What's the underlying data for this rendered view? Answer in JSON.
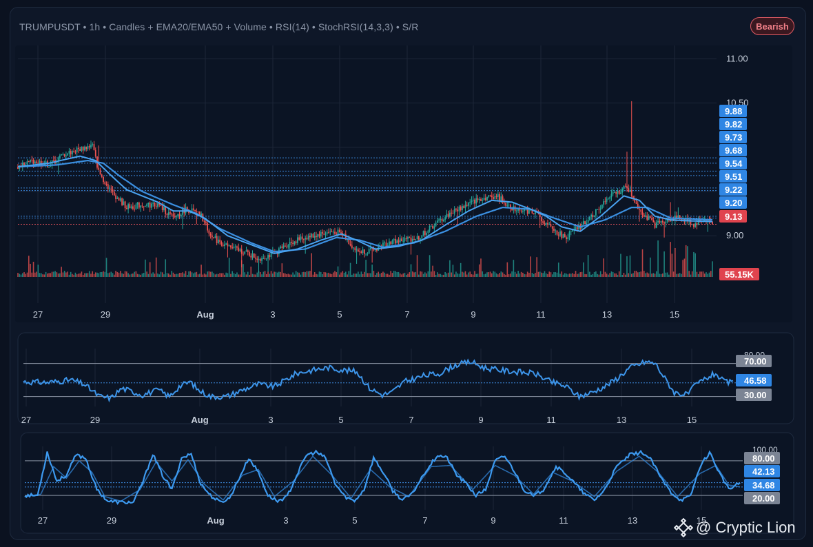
{
  "header": {
    "title": "TRUMPUSDT • 1h • Candles + EMA20/EMA50 + Volume • RSI(14) • StochRSI(14,3,3) • S/R",
    "badge": "Bearish"
  },
  "colors": {
    "up": "#26a69a",
    "down": "#ef5350",
    "ema": "#3b8fe0",
    "grid": "#1c2638",
    "level": "#3f8fe6",
    "levelRed": "#e0505a",
    "badgeBlue": "#2f86e4",
    "badgeRed": "#e0444e"
  },
  "chart_data": [
    {
      "type": "candlestick",
      "title": "TRUMPUSDT • 1h",
      "x_ticks": [
        "27",
        "29",
        "Aug",
        "3",
        "5",
        "7",
        "9",
        "11",
        "13",
        "15"
      ],
      "y_ticks": [
        "11.00",
        "10.50",
        "9.00"
      ],
      "ylim": [
        8.55,
        11.15
      ],
      "close_anchors": [
        [
          0,
          9.78
        ],
        [
          10,
          9.85
        ],
        [
          20,
          9.8
        ],
        [
          30,
          9.92
        ],
        [
          40,
          9.98
        ],
        [
          48,
          10.02
        ],
        [
          52,
          9.72
        ],
        [
          60,
          9.5
        ],
        [
          70,
          9.32
        ],
        [
          80,
          9.35
        ],
        [
          90,
          9.35
        ],
        [
          100,
          9.2
        ],
        [
          108,
          9.3
        ],
        [
          112,
          9.28
        ],
        [
          118,
          9.22
        ],
        [
          125,
          8.98
        ],
        [
          135,
          8.88
        ],
        [
          145,
          8.82
        ],
        [
          155,
          8.74
        ],
        [
          165,
          8.8
        ],
        [
          175,
          8.92
        ],
        [
          185,
          8.98
        ],
        [
          195,
          9.02
        ],
        [
          205,
          9.05
        ],
        [
          210,
          9.0
        ],
        [
          218,
          8.82
        ],
        [
          228,
          8.83
        ],
        [
          238,
          8.92
        ],
        [
          248,
          8.95
        ],
        [
          258,
          8.98
        ],
        [
          268,
          9.12
        ],
        [
          278,
          9.25
        ],
        [
          288,
          9.34
        ],
        [
          298,
          9.42
        ],
        [
          308,
          9.45
        ],
        [
          318,
          9.32
        ],
        [
          328,
          9.28
        ],
        [
          335,
          9.25
        ],
        [
          340,
          9.12
        ],
        [
          352,
          8.98
        ],
        [
          362,
          9.1
        ],
        [
          372,
          9.28
        ],
        [
          382,
          9.45
        ],
        [
          392,
          9.55
        ],
        [
          400,
          9.3
        ],
        [
          405,
          9.2
        ],
        [
          410,
          9.12
        ],
        [
          418,
          9.18
        ],
        [
          425,
          9.2
        ],
        [
          430,
          9.18
        ],
        [
          435,
          9.12
        ],
        [
          440,
          9.18
        ],
        [
          447,
          9.15
        ]
      ],
      "spikes": [
        [
          52,
          10.02
        ],
        [
          395,
          10.52
        ],
        [
          392,
          9.95
        ],
        [
          420,
          9.38
        ],
        [
          425,
          9.32
        ]
      ],
      "total_candles": 448,
      "ema20_anchors": [
        [
          0,
          9.78
        ],
        [
          20,
          9.82
        ],
        [
          40,
          9.9
        ],
        [
          50,
          9.85
        ],
        [
          60,
          9.68
        ],
        [
          70,
          9.52
        ],
        [
          90,
          9.38
        ],
        [
          100,
          9.28
        ],
        [
          110,
          9.28
        ],
        [
          120,
          9.2
        ],
        [
          135,
          9.0
        ],
        [
          150,
          8.9
        ],
        [
          165,
          8.8
        ],
        [
          180,
          8.85
        ],
        [
          195,
          8.95
        ],
        [
          208,
          9.02
        ],
        [
          218,
          8.95
        ],
        [
          230,
          8.85
        ],
        [
          245,
          8.88
        ],
        [
          260,
          8.95
        ],
        [
          275,
          9.12
        ],
        [
          290,
          9.28
        ],
        [
          305,
          9.4
        ],
        [
          318,
          9.38
        ],
        [
          330,
          9.3
        ],
        [
          340,
          9.22
        ],
        [
          350,
          9.1
        ],
        [
          362,
          9.05
        ],
        [
          375,
          9.22
        ],
        [
          390,
          9.45
        ],
        [
          400,
          9.4
        ],
        [
          410,
          9.22
        ],
        [
          420,
          9.18
        ],
        [
          430,
          9.17
        ],
        [
          447,
          9.16
        ]
      ],
      "ema50_anchors": [
        [
          0,
          9.78
        ],
        [
          25,
          9.8
        ],
        [
          45,
          9.85
        ],
        [
          55,
          9.82
        ],
        [
          65,
          9.68
        ],
        [
          80,
          9.5
        ],
        [
          100,
          9.35
        ],
        [
          115,
          9.25
        ],
        [
          130,
          9.08
        ],
        [
          150,
          8.92
        ],
        [
          165,
          8.82
        ],
        [
          185,
          8.85
        ],
        [
          205,
          8.98
        ],
        [
          220,
          8.95
        ],
        [
          235,
          8.87
        ],
        [
          255,
          8.92
        ],
        [
          275,
          9.05
        ],
        [
          295,
          9.22
        ],
        [
          312,
          9.32
        ],
        [
          330,
          9.3
        ],
        [
          345,
          9.2
        ],
        [
          362,
          9.1
        ],
        [
          378,
          9.18
        ],
        [
          395,
          9.32
        ],
        [
          405,
          9.32
        ],
        [
          420,
          9.2
        ],
        [
          447,
          9.18
        ]
      ],
      "sr_levels": [
        9.88,
        9.82,
        9.73,
        9.68,
        9.54,
        9.51,
        9.22,
        9.2
      ],
      "sr_levels_red": [
        9.13
      ],
      "price_labels": [
        "9.88",
        "9.82",
        "9.73",
        "9.68",
        "9.54",
        "9.51",
        "9.22",
        "9.20"
      ],
      "current_price": "9.13",
      "volume_label": "55.15K"
    },
    {
      "type": "line",
      "title": "RSI(14)",
      "ylim": [
        18,
        88
      ],
      "y_ticks": [
        "80.00"
      ],
      "x_ticks": [
        "27",
        "29",
        "Aug",
        "3",
        "5",
        "7",
        "9",
        "11",
        "13",
        "15"
      ],
      "reference_lines": [
        70,
        30
      ],
      "labels": {
        "upper": "70.00",
        "current": "46.58",
        "lower": "30.00"
      },
      "anchors": [
        [
          0,
          48
        ],
        [
          15,
          47
        ],
        [
          30,
          50
        ],
        [
          38,
          45
        ],
        [
          48,
          30
        ],
        [
          55,
          28
        ],
        [
          62,
          40
        ],
        [
          75,
          32
        ],
        [
          85,
          38
        ],
        [
          92,
          30
        ],
        [
          98,
          42
        ],
        [
          105,
          48
        ],
        [
          110,
          38
        ],
        [
          118,
          30
        ],
        [
          128,
          30
        ],
        [
          138,
          38
        ],
        [
          148,
          45
        ],
        [
          158,
          42
        ],
        [
          165,
          50
        ],
        [
          172,
          58
        ],
        [
          182,
          62
        ],
        [
          192,
          65
        ],
        [
          202,
          62
        ],
        [
          210,
          60
        ],
        [
          218,
          40
        ],
        [
          226,
          32
        ],
        [
          232,
          35
        ],
        [
          240,
          48
        ],
        [
          252,
          55
        ],
        [
          262,
          58
        ],
        [
          272,
          68
        ],
        [
          282,
          72
        ],
        [
          290,
          65
        ],
        [
          300,
          62
        ],
        [
          310,
          60
        ],
        [
          322,
          58
        ],
        [
          332,
          48
        ],
        [
          342,
          42
        ],
        [
          350,
          30
        ],
        [
          358,
          35
        ],
        [
          366,
          42
        ],
        [
          374,
          52
        ],
        [
          382,
          65
        ],
        [
          392,
          72
        ],
        [
          398,
          70
        ],
        [
          404,
          52
        ],
        [
          410,
          35
        ],
        [
          418,
          32
        ],
        [
          424,
          45
        ],
        [
          430,
          52
        ],
        [
          436,
          58
        ],
        [
          441,
          48
        ],
        [
          447,
          46.58
        ]
      ]
    },
    {
      "type": "line",
      "title": "StochRSI(14,3,3)",
      "ylim": [
        -5,
        105
      ],
      "y_ticks": [
        "100.00"
      ],
      "x_ticks": [
        "27",
        "29",
        "Aug",
        "3",
        "5",
        "7",
        "9",
        "11",
        "13",
        "15"
      ],
      "reference_lines": [
        80,
        20
      ],
      "labels": {
        "upper": "80.00",
        "k": "42.13",
        "d": "34.68",
        "lower": "20.00"
      },
      "anchors": [
        [
          0,
          20
        ],
        [
          8,
          20
        ],
        [
          14,
          95
        ],
        [
          20,
          45
        ],
        [
          26,
          55
        ],
        [
          32,
          90
        ],
        [
          38,
          85
        ],
        [
          45,
          30
        ],
        [
          52,
          10
        ],
        [
          60,
          8
        ],
        [
          68,
          8
        ],
        [
          74,
          45
        ],
        [
          80,
          92
        ],
        [
          86,
          55
        ],
        [
          92,
          30
        ],
        [
          98,
          85
        ],
        [
          104,
          92
        ],
        [
          110,
          40
        ],
        [
          116,
          20
        ],
        [
          122,
          8
        ],
        [
          128,
          15
        ],
        [
          134,
          50
        ],
        [
          140,
          85
        ],
        [
          146,
          60
        ],
        [
          152,
          20
        ],
        [
          158,
          10
        ],
        [
          164,
          18
        ],
        [
          170,
          55
        ],
        [
          176,
          90
        ],
        [
          182,
          95
        ],
        [
          188,
          85
        ],
        [
          194,
          40
        ],
        [
          200,
          18
        ],
        [
          206,
          10
        ],
        [
          212,
          30
        ],
        [
          218,
          85
        ],
        [
          224,
          60
        ],
        [
          230,
          28
        ],
        [
          236,
          12
        ],
        [
          242,
          22
        ],
        [
          250,
          60
        ],
        [
          258,
          90
        ],
        [
          264,
          85
        ],
        [
          270,
          55
        ],
        [
          276,
          40
        ],
        [
          282,
          20
        ],
        [
          288,
          30
        ],
        [
          294,
          80
        ],
        [
          300,
          88
        ],
        [
          306,
          62
        ],
        [
          312,
          30
        ],
        [
          318,
          18
        ],
        [
          324,
          30
        ],
        [
          332,
          70
        ],
        [
          338,
          58
        ],
        [
          344,
          40
        ],
        [
          350,
          22
        ],
        [
          356,
          12
        ],
        [
          362,
          28
        ],
        [
          370,
          70
        ],
        [
          378,
          90
        ],
        [
          386,
          95
        ],
        [
          392,
          80
        ],
        [
          398,
          48
        ],
        [
          404,
          25
        ],
        [
          410,
          12
        ],
        [
          416,
          18
        ],
        [
          422,
          70
        ],
        [
          428,
          95
        ],
        [
          434,
          60
        ],
        [
          440,
          30
        ],
        [
          447,
          42
        ]
      ],
      "anchors_d": [
        [
          0,
          18
        ],
        [
          10,
          22
        ],
        [
          18,
          70
        ],
        [
          26,
          50
        ],
        [
          34,
          80
        ],
        [
          42,
          60
        ],
        [
          50,
          18
        ],
        [
          60,
          10
        ],
        [
          72,
          30
        ],
        [
          82,
          78
        ],
        [
          92,
          45
        ],
        [
          102,
          82
        ],
        [
          112,
          40
        ],
        [
          124,
          12
        ],
        [
          136,
          55
        ],
        [
          146,
          65
        ],
        [
          156,
          18
        ],
        [
          168,
          45
        ],
        [
          180,
          88
        ],
        [
          192,
          55
        ],
        [
          204,
          15
        ],
        [
          216,
          65
        ],
        [
          228,
          35
        ],
        [
          240,
          18
        ],
        [
          254,
          70
        ],
        [
          266,
          72
        ],
        [
          280,
          30
        ],
        [
          294,
          72
        ],
        [
          306,
          55
        ],
        [
          318,
          22
        ],
        [
          330,
          60
        ],
        [
          342,
          45
        ],
        [
          356,
          18
        ],
        [
          370,
          62
        ],
        [
          384,
          88
        ],
        [
          396,
          60
        ],
        [
          408,
          18
        ],
        [
          422,
          58
        ],
        [
          432,
          72
        ],
        [
          440,
          38
        ],
        [
          447,
          34.68
        ]
      ]
    }
  ],
  "watermark": {
    "text": "@ Cryptic Lion"
  }
}
